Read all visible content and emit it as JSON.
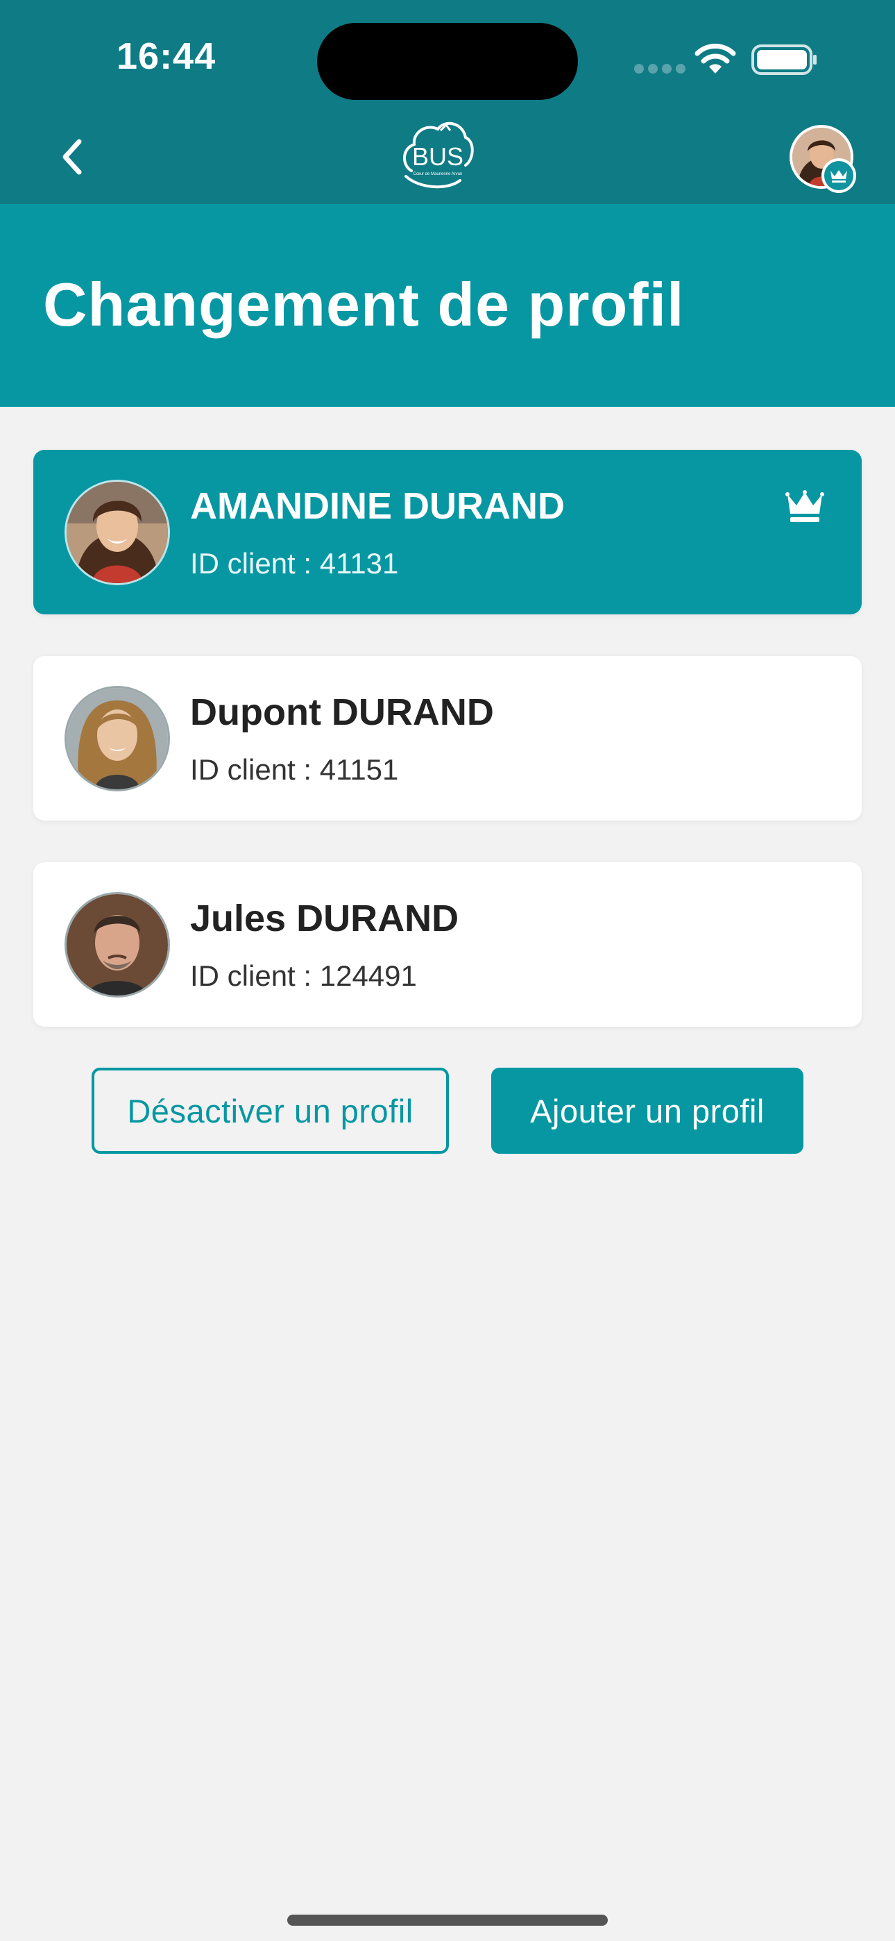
{
  "status_bar": {
    "time": "16:44"
  },
  "nav": {
    "logo_text": "BUS",
    "logo_subtext": "Cœur de Maurienne Arvan"
  },
  "page": {
    "title": "Changement de profil"
  },
  "profiles": [
    {
      "name": "AMANDINE DURAND",
      "client_id": "ID client : 41131",
      "active": true,
      "owner": true
    },
    {
      "name": "Dupont DURAND",
      "client_id": "ID client : 41151",
      "active": false,
      "owner": false
    },
    {
      "name": "Jules DURAND",
      "client_id": "ID client : 124491",
      "active": false,
      "owner": false
    }
  ],
  "actions": {
    "deactivate_label": "Désactiver un profil",
    "add_label": "Ajouter un profil"
  },
  "colors": {
    "nav_bg": "#0f7b85",
    "brand": "#0697a2",
    "background": "#f2f2f2"
  },
  "icons": {
    "back": "chevron-left-icon",
    "owner": "crown-icon",
    "wifi": "wifi-icon",
    "battery": "battery-icon"
  }
}
